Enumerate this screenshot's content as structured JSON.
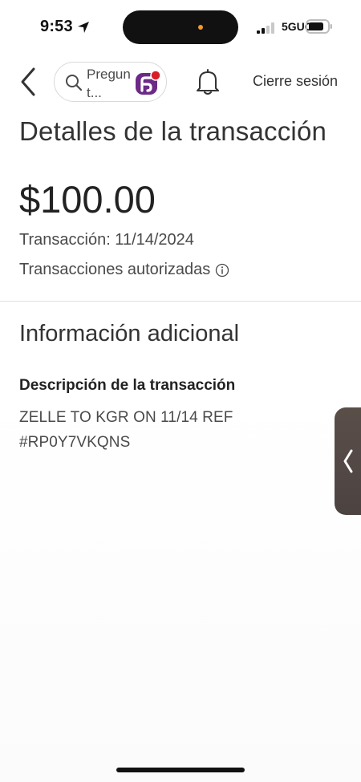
{
  "status_bar": {
    "time": "9:53",
    "network": "5GUC"
  },
  "header": {
    "search_text": "Preg­unt...",
    "logout_label": "Cierre sesión",
    "icons": [
      "chevron-left-icon",
      "search-icon",
      "fargo-logo-icon",
      "bell-icon"
    ]
  },
  "transaction": {
    "title": "Detalles de la transacción",
    "amount": "$100.00",
    "date_line": "Transacción: 11/14/2024",
    "status": "Transacciones autorizadas"
  },
  "additional": {
    "section_title": "Información adicional",
    "description_label": "Descripción de la transacción",
    "description_value": "ZELLE TO KGR ON 11/14 REF #RP0Y7VKQNS"
  },
  "colors": {
    "text": "#333333",
    "divider": "#e0e0e0",
    "brand_purple": "#6c2a86",
    "brand_red": "#d71e28",
    "side_tab": "#544a46"
  }
}
